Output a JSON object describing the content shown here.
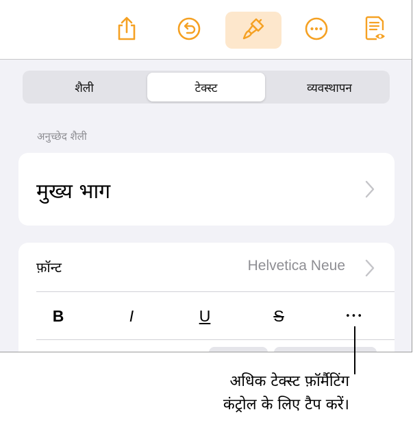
{
  "toolbar": {
    "buttons": [
      {
        "icon": "share-icon"
      },
      {
        "icon": "undo-icon"
      },
      {
        "icon": "paintbrush-icon",
        "selected": true
      },
      {
        "icon": "more-icon"
      },
      {
        "icon": "reading-view-icon"
      }
    ],
    "accent_color": "#f5a123"
  },
  "segmented_control": {
    "tabs": [
      {
        "label": "शैली"
      },
      {
        "label": "टेक्स्ट"
      },
      {
        "label": "व्यवस्थापन"
      }
    ],
    "selected": "टेक्स्ट"
  },
  "paragraph_style": {
    "section_label": "अनुच्छेद शैली",
    "value": "मुख्य भाग"
  },
  "font": {
    "label": "फ़ॉन्ट",
    "value": "Helvetica Neue"
  },
  "format_buttons": {
    "bold": "B",
    "italic": "I",
    "underline": "U",
    "strikethrough": "S",
    "more": "•••"
  },
  "callout": {
    "line1": "अधिक टेक्स्ट फ़ॉर्मैटिंग",
    "line2": "कंट्रोल के लिए टैप करें।"
  }
}
